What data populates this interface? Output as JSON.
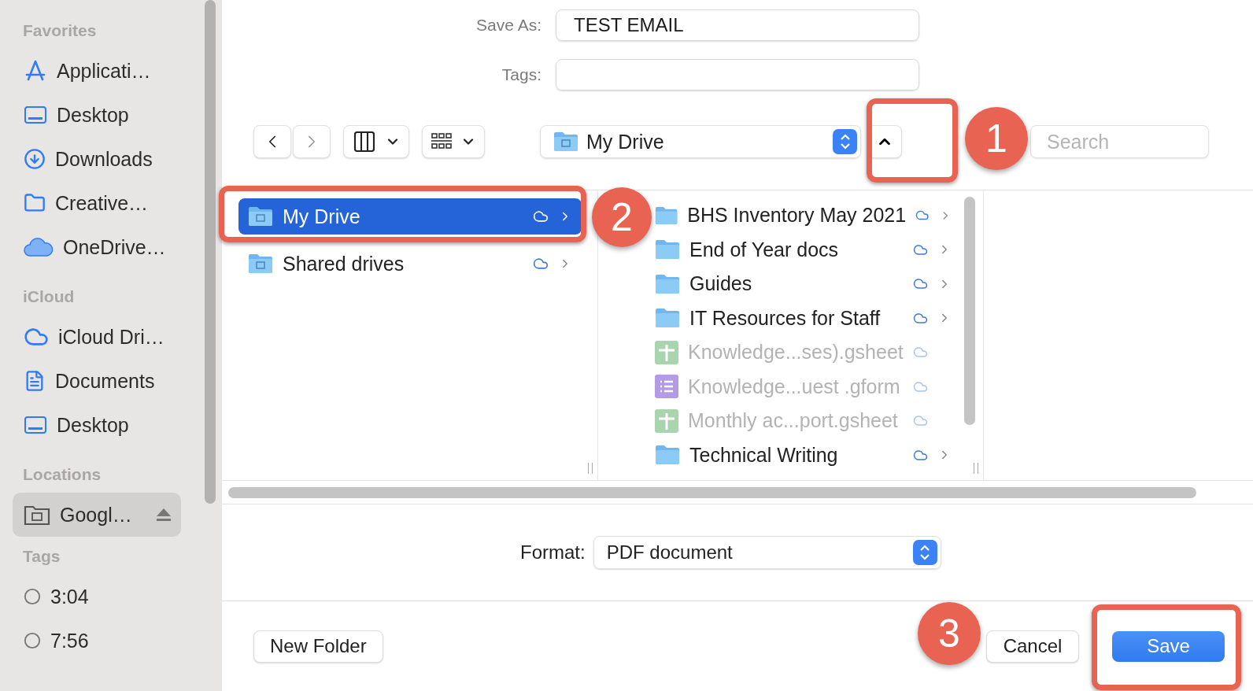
{
  "sidebar": {
    "sections": [
      {
        "title": "Favorites",
        "items": [
          {
            "label": "Applicati…",
            "kind": "apps",
            "selected": false
          },
          {
            "label": "Desktop",
            "kind": "desktop",
            "selected": false
          },
          {
            "label": "Downloads",
            "kind": "downloads",
            "selected": false
          },
          {
            "label": "Creative…",
            "kind": "folder",
            "selected": false
          },
          {
            "label": "OneDrive…",
            "kind": "onedrive",
            "selected": false
          }
        ]
      },
      {
        "title": "iCloud",
        "items": [
          {
            "label": "iCloud Dri…",
            "kind": "icloud",
            "selected": false
          },
          {
            "label": "Documents",
            "kind": "document",
            "selected": false
          },
          {
            "label": "Desktop",
            "kind": "desktop",
            "selected": false
          }
        ]
      },
      {
        "title": "Locations",
        "items": [
          {
            "label": "Googl…",
            "kind": "drive",
            "selected": true
          }
        ]
      },
      {
        "title": "Tags",
        "items": [
          {
            "label": "3:04",
            "kind": "tag",
            "selected": false
          },
          {
            "label": "7:56",
            "kind": "tag",
            "selected": false
          }
        ]
      }
    ]
  },
  "save_as": {
    "label": "Save As:",
    "value": "TEST EMAIL"
  },
  "tags": {
    "label": "Tags:"
  },
  "toolbar": {
    "location": "My Drive",
    "search": {
      "placeholder": "Search"
    }
  },
  "browser": {
    "column_1": [
      {
        "name": "My Drive",
        "selected": true
      },
      {
        "name": "Shared drives",
        "selected": false
      }
    ],
    "column_2": [
      {
        "name": "BHS Inventory May 2021",
        "kind": "folder",
        "disabled": false
      },
      {
        "name": "End of Year docs",
        "kind": "folder",
        "disabled": false
      },
      {
        "name": "Guides",
        "kind": "folder",
        "disabled": false
      },
      {
        "name": "IT Resources for Staff",
        "kind": "folder",
        "disabled": false
      },
      {
        "name": "Knowledge...ses).gsheet",
        "kind": "sheet",
        "disabled": true
      },
      {
        "name": "Knowledge...uest .gform",
        "kind": "form",
        "disabled": true
      },
      {
        "name": "Monthly ac...port.gsheet",
        "kind": "sheet",
        "disabled": true
      },
      {
        "name": "Technical Writing",
        "kind": "folder",
        "disabled": false
      }
    ]
  },
  "format": {
    "label": "Format:",
    "value": "PDF document"
  },
  "buttons": {
    "new_folder": "New Folder",
    "cancel": "Cancel",
    "save": "Save"
  },
  "callouts": [
    {
      "label": "1"
    },
    {
      "label": "2"
    },
    {
      "label": "3"
    }
  ]
}
